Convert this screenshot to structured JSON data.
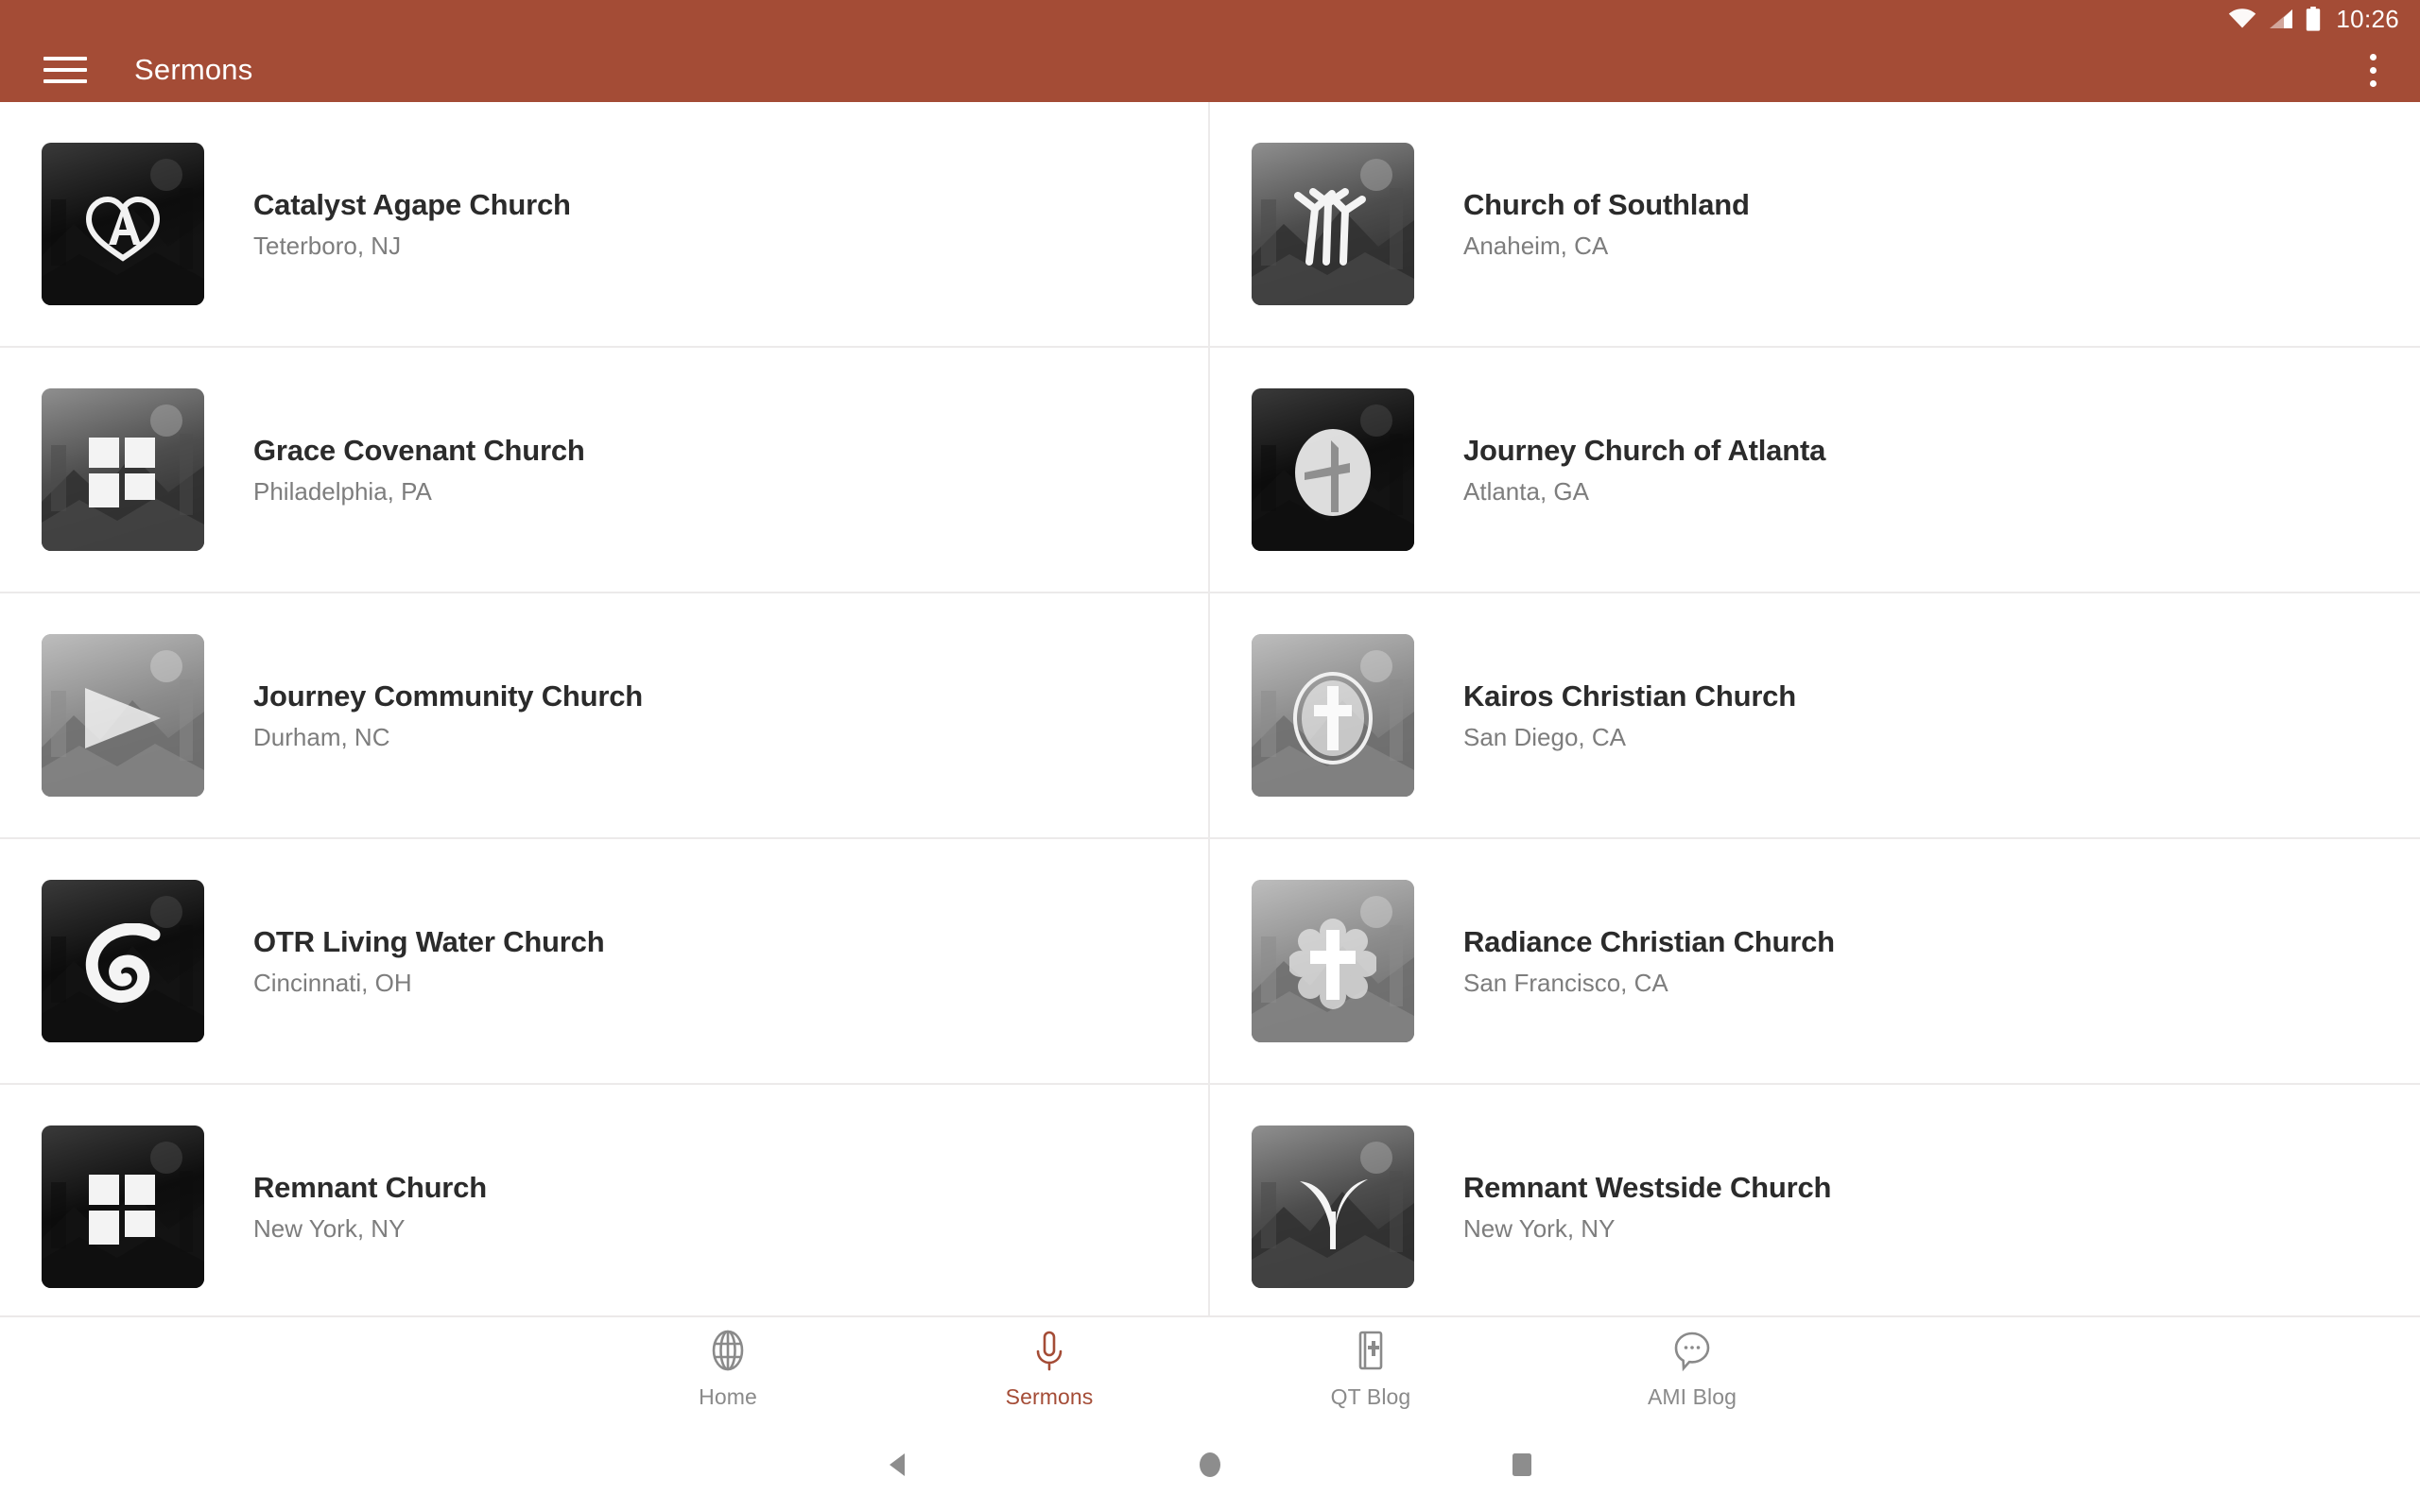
{
  "status_bar": {
    "time": "10:26",
    "icons": [
      "wifi-icon",
      "cellular-signal-icon",
      "battery-icon"
    ]
  },
  "toolbar": {
    "menu_icon": "hamburger-menu-icon",
    "title": "Sermons",
    "overflow_icon": "more-vertical-icon",
    "background_color": "#a44c36"
  },
  "colors": {
    "accent": "#a44c36",
    "title_text": "#2b2b2b",
    "secondary_text": "#7d7d7d",
    "divider": "#eceaea",
    "inactive_nav": "#8a8a8a"
  },
  "church_list": [
    {
      "name": "Catalyst Agape Church",
      "location": "Teterboro, NJ",
      "logo": "agape-a-heart-logo",
      "thumb_tone": "dark"
    },
    {
      "name": "Church of Southland",
      "location": "Anaheim, CA",
      "logo": "southland-strokes-logo",
      "thumb_tone": "mid"
    },
    {
      "name": "Grace Covenant Church",
      "location": "Philadelphia, PA",
      "logo": "four-squares-logo",
      "thumb_tone": "mid"
    },
    {
      "name": "Journey Church of Atlanta",
      "location": "Atlanta, GA",
      "logo": "circle-cross-logo",
      "thumb_tone": "dark"
    },
    {
      "name": "Journey Community Church",
      "location": "Durham, NC",
      "logo": "play-triangle-logo",
      "thumb_tone": "light"
    },
    {
      "name": "Kairos Christian Church",
      "location": "San Diego, CA",
      "logo": "oval-cross-logo",
      "thumb_tone": "light"
    },
    {
      "name": "OTR Living Water Church",
      "location": "Cincinnati, OH",
      "logo": "wave-swirl-logo",
      "thumb_tone": "dark"
    },
    {
      "name": "Radiance Christian Church",
      "location": "San Francisco, CA",
      "logo": "starburst-cross-logo",
      "thumb_tone": "light"
    },
    {
      "name": "Remnant Church",
      "location": "New York, NY",
      "logo": "four-squares-logo",
      "thumb_tone": "dark"
    },
    {
      "name": "Remnant Westside Church",
      "location": "New York, NY",
      "logo": "leaf-pair-logo",
      "thumb_tone": "mid"
    }
  ],
  "bottom_nav": {
    "items": [
      {
        "label": "Home",
        "icon": "globe-icon",
        "active": false
      },
      {
        "label": "Sermons",
        "icon": "microphone-icon",
        "active": true
      },
      {
        "label": "QT Blog",
        "icon": "bible-book-icon",
        "active": false
      },
      {
        "label": "AMI Blog",
        "icon": "chat-bubble-icon",
        "active": false
      }
    ]
  },
  "system_nav": {
    "buttons": [
      {
        "name": "back-button",
        "icon": "triangle-back-icon"
      },
      {
        "name": "home-button",
        "icon": "circle-home-icon"
      },
      {
        "name": "recents-button",
        "icon": "square-recents-icon"
      }
    ]
  }
}
